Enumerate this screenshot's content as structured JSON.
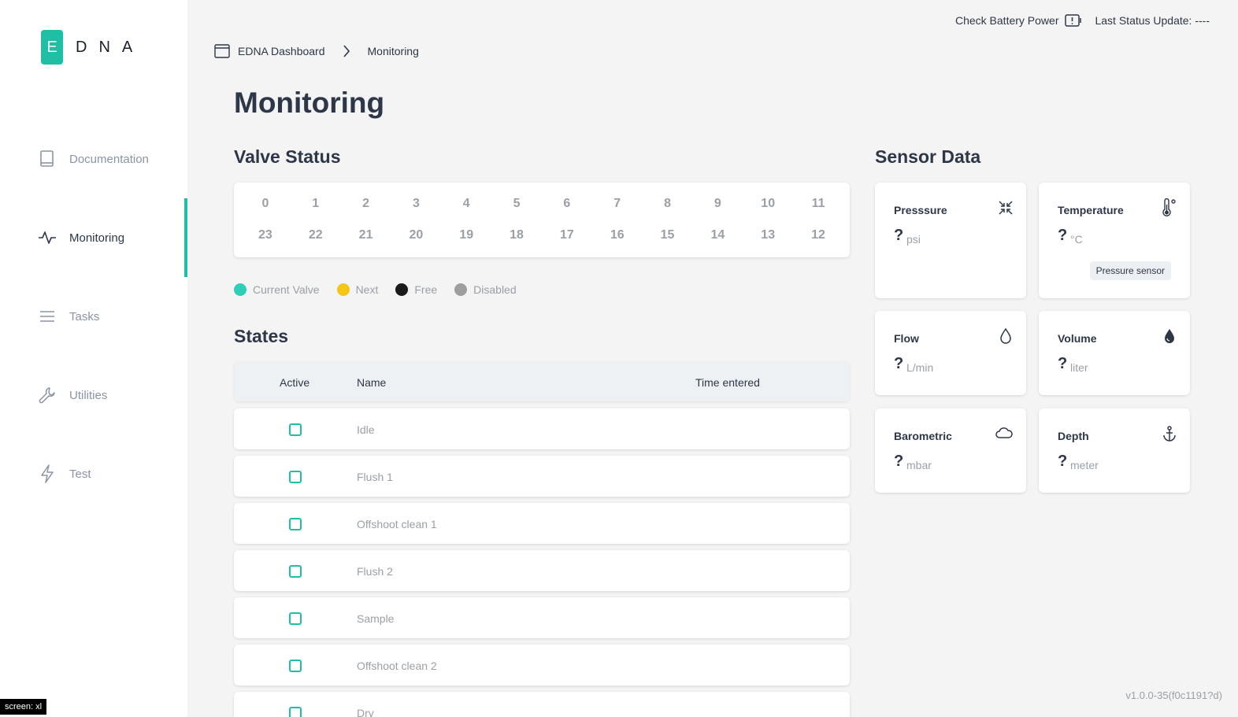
{
  "app": {
    "logo_letter": "E",
    "logo_rest": "DNA",
    "version": "v1.0.0-35(f0c1191?d)",
    "screen_tag": "screen: xl"
  },
  "sidebar": {
    "items": [
      {
        "label": "Documentation",
        "icon": "book-icon",
        "active": false
      },
      {
        "label": "Monitoring",
        "icon": "activity-icon",
        "active": true
      },
      {
        "label": "Tasks",
        "icon": "menu-icon",
        "active": false
      },
      {
        "label": "Utilities",
        "icon": "wrench-icon",
        "active": false
      },
      {
        "label": "Test",
        "icon": "lightning-icon",
        "active": false
      }
    ]
  },
  "topbar": {
    "battery_label": "Check Battery Power",
    "status_label": "Last Status Update: ----"
  },
  "breadcrumb": {
    "root": "EDNA Dashboard",
    "current": "Monitoring"
  },
  "page": {
    "title": "Monitoring"
  },
  "valves": {
    "title": "Valve Status",
    "top_row": [
      "0",
      "1",
      "2",
      "3",
      "4",
      "5",
      "6",
      "7",
      "8",
      "9",
      "10",
      "11"
    ],
    "bottom_row": [
      "23",
      "22",
      "21",
      "20",
      "19",
      "18",
      "17",
      "16",
      "15",
      "14",
      "13",
      "12"
    ],
    "legend": [
      {
        "label": "Current Valve",
        "color": "#2ecfb9"
      },
      {
        "label": "Next",
        "color": "#f5c518"
      },
      {
        "label": "Free",
        "color": "#1a1a1a"
      },
      {
        "label": "Disabled",
        "color": "#9e9e9e"
      }
    ]
  },
  "states": {
    "title": "States",
    "columns": {
      "active": "Active",
      "name": "Name",
      "time": "Time entered"
    },
    "rows": [
      {
        "name": "Idle"
      },
      {
        "name": "Flush 1"
      },
      {
        "name": "Offshoot clean 1"
      },
      {
        "name": "Flush 2"
      },
      {
        "name": "Sample"
      },
      {
        "name": "Offshoot clean 2"
      },
      {
        "name": "Dry"
      }
    ]
  },
  "sensors": {
    "title": "Sensor Data",
    "items": [
      {
        "title": "Presssure",
        "value": "?",
        "unit": "psi",
        "icon": "compress-icon"
      },
      {
        "title": "Temperature",
        "value": "?",
        "unit": "°C",
        "icon": "thermometer-icon",
        "badge": "Pressure sensor"
      },
      {
        "title": "Flow",
        "value": "?",
        "unit": "L/min",
        "icon": "droplet-outline-icon"
      },
      {
        "title": "Volume",
        "value": "?",
        "unit": "liter",
        "icon": "droplet-filled-icon"
      },
      {
        "title": "Barometric",
        "value": "?",
        "unit": "mbar",
        "icon": "cloud-icon"
      },
      {
        "title": "Depth",
        "value": "?",
        "unit": "meter",
        "icon": "anchor-icon"
      }
    ]
  },
  "colors": {
    "accent": "#1fbfa5",
    "background": "#f4f4f4"
  }
}
